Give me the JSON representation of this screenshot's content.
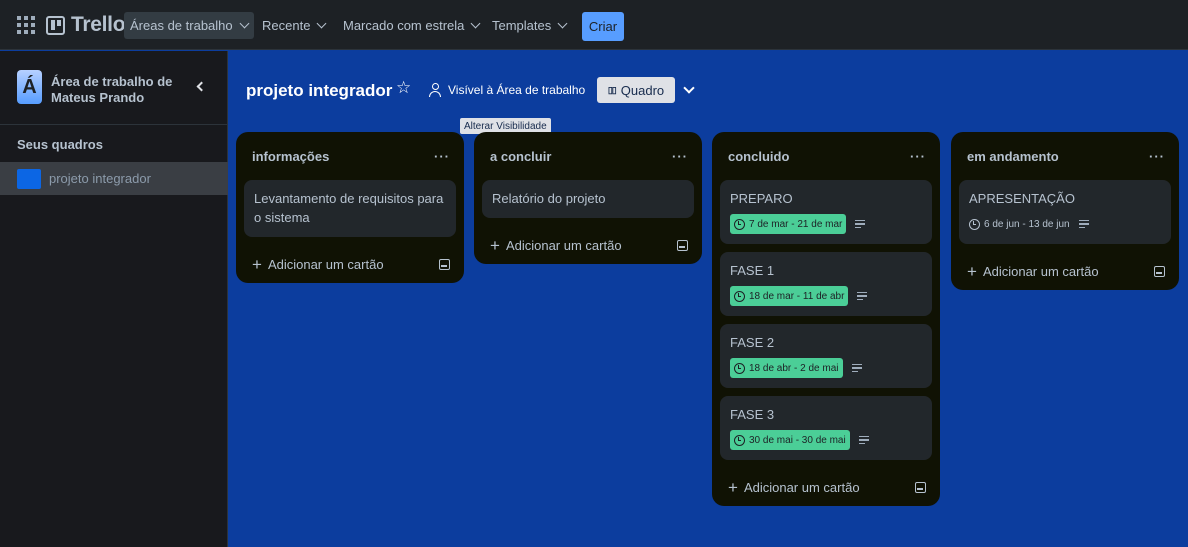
{
  "topnav": {
    "logo_text": "Trello",
    "items": [
      {
        "label": "Áreas de trabalho"
      },
      {
        "label": "Recente"
      },
      {
        "label": "Marcado com estrela"
      },
      {
        "label": "Templates"
      }
    ],
    "create_label": "Criar"
  },
  "sidebar": {
    "workspace_initial": "Á",
    "workspace_name": "Área de trabalho de Mateus Prando",
    "section_title": "Seus quadros",
    "boards": [
      {
        "name": "projeto integrador"
      }
    ]
  },
  "board": {
    "title": "projeto integrador",
    "visibility_label": "Visível à Área de trabalho",
    "view_label": "Quadro",
    "tooltip": "Alterar Visibilidade"
  },
  "lists": [
    {
      "title": "informações",
      "cards": [
        {
          "title": "Levantamento de requisitos para o sistema"
        }
      ],
      "add_label": "Adicionar um cartão"
    },
    {
      "title": "a concluir",
      "cards": [
        {
          "title": "Relatório do projeto"
        }
      ],
      "add_label": "Adicionar um cartão"
    },
    {
      "title": "concluido",
      "cards": [
        {
          "title": "PREPARO",
          "due": "7 de mar - 21 de mar"
        },
        {
          "title": "FASE 1",
          "due": "18 de mar - 11 de abr"
        },
        {
          "title": "FASE 2",
          "due": "18 de abr - 2 de mai"
        },
        {
          "title": "FASE 3",
          "due": "30 de mai - 30 de mai"
        }
      ],
      "add_label": "Adicionar um cartão"
    },
    {
      "title": "em andamento",
      "cards": [
        {
          "title": "APRESENTAÇÃO",
          "due": "6 de jun - 13 de jun"
        }
      ],
      "add_label": "Adicionar um cartão"
    }
  ],
  "colors": {
    "board_bg": "#0c3d9e",
    "list_bg": "#101204",
    "due_complete": "#4bce97",
    "accent": "#579dff"
  }
}
